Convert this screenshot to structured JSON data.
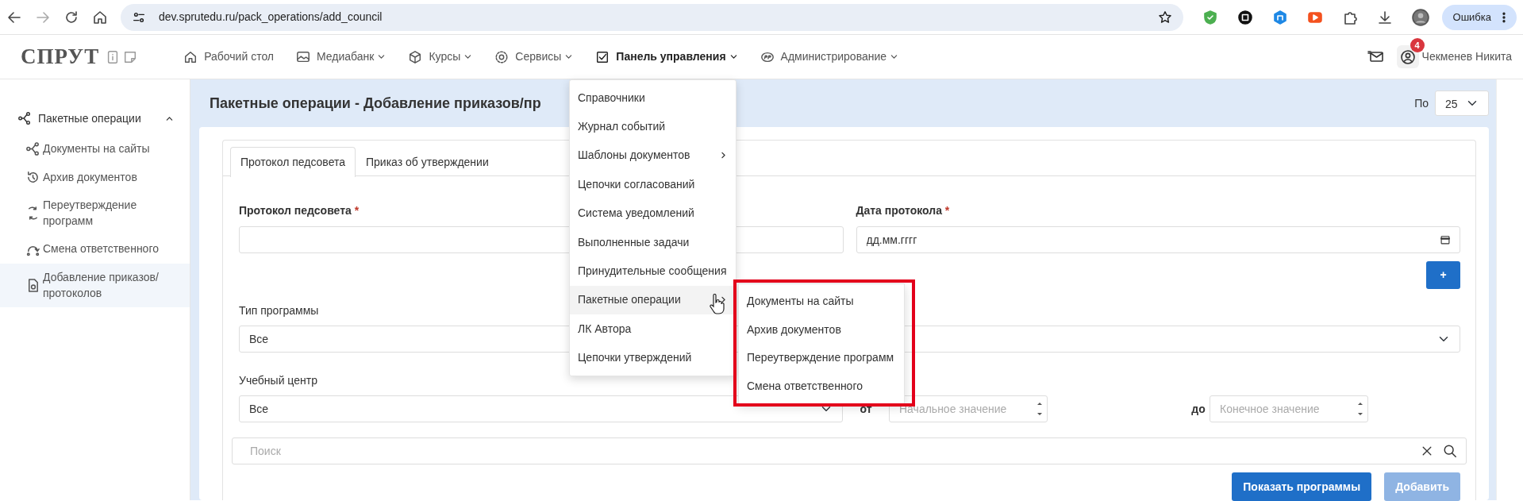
{
  "browser": {
    "url": "dev.sprutedu.ru/pack_operations/add_council",
    "profile_button": "Ошибка"
  },
  "navbar": {
    "logo": "СПРУТ",
    "items": [
      {
        "label": "Рабочий стол",
        "has_caret": false,
        "expanded": false
      },
      {
        "label": "Медиабанк",
        "has_caret": true,
        "expanded": false
      },
      {
        "label": "Курсы",
        "has_caret": true,
        "expanded": false
      },
      {
        "label": "Сервисы",
        "has_caret": true,
        "expanded": false
      },
      {
        "label": "Панель управления",
        "has_caret": true,
        "expanded": true
      },
      {
        "label": "Администрирование",
        "has_caret": true,
        "expanded": false
      }
    ],
    "notification_count": "4",
    "user_name": "Чекменев Никита"
  },
  "sidebar": {
    "items": [
      {
        "label": "Пакетные операции",
        "expanded": true,
        "children": [
          {
            "label": "Документы на сайты",
            "selected": false
          },
          {
            "label": "Архив документов",
            "selected": false
          },
          {
            "label": "Переутверждение программ",
            "selected": false
          },
          {
            "label": "Смена ответственного",
            "selected": false
          },
          {
            "label": "Добавление приказов/ протоколов",
            "selected": true
          }
        ]
      }
    ]
  },
  "page": {
    "title": "Пакетные операции - Добавление приказов/пр",
    "per_page_label": "По",
    "per_page_value": "25"
  },
  "tabs": [
    {
      "label": "Протокол педсовета",
      "selected": true
    },
    {
      "label": "Приказ об утверждении",
      "selected": false
    }
  ],
  "form": {
    "protocol": {
      "label": "Протокол педсовета",
      "required_mark": "*"
    },
    "protocol_date": {
      "label": "Дата протокола",
      "required_mark": "*",
      "value": "дд.мм.гггг"
    },
    "add_button": "+",
    "program_type": {
      "label": "Тип программы",
      "value": "Все"
    },
    "training_center": {
      "label": "Учебный центр",
      "value": "Все"
    },
    "range_from": {
      "label": "от",
      "placeholder": "Начальное значение"
    },
    "range_to": {
      "label": "до",
      "placeholder": "Конечное значение"
    },
    "search": {
      "placeholder": "Поиск"
    },
    "buttons": [
      {
        "label": "Показать программы",
        "disabled": false
      },
      {
        "label": "Добавить",
        "disabled": true
      }
    ]
  },
  "dropdown": {
    "items": [
      {
        "label": "Справочники",
        "has_submenu": false,
        "selected": false
      },
      {
        "label": "Журнал событий",
        "has_submenu": false,
        "selected": false
      },
      {
        "label": "Шаблоны документов",
        "has_submenu": true,
        "selected": false
      },
      {
        "label": "Цепочки согласований",
        "has_submenu": false,
        "selected": false
      },
      {
        "label": "Система уведомлений",
        "has_submenu": false,
        "selected": false
      },
      {
        "label": "Выполненные задачи",
        "has_submenu": false,
        "selected": false
      },
      {
        "label": "Принудительные сообщения",
        "has_submenu": false,
        "selected": false
      },
      {
        "label": "Пакетные операции",
        "has_submenu": true,
        "selected": true
      },
      {
        "label": "ЛК Автора",
        "has_submenu": false,
        "selected": false
      },
      {
        "label": "Цепочки утверждений",
        "has_submenu": false,
        "selected": false
      }
    ]
  },
  "submenu": {
    "items": [
      "Документы на сайты",
      "Архив документов",
      "Переутверждение программ",
      "Смена ответственного"
    ]
  }
}
